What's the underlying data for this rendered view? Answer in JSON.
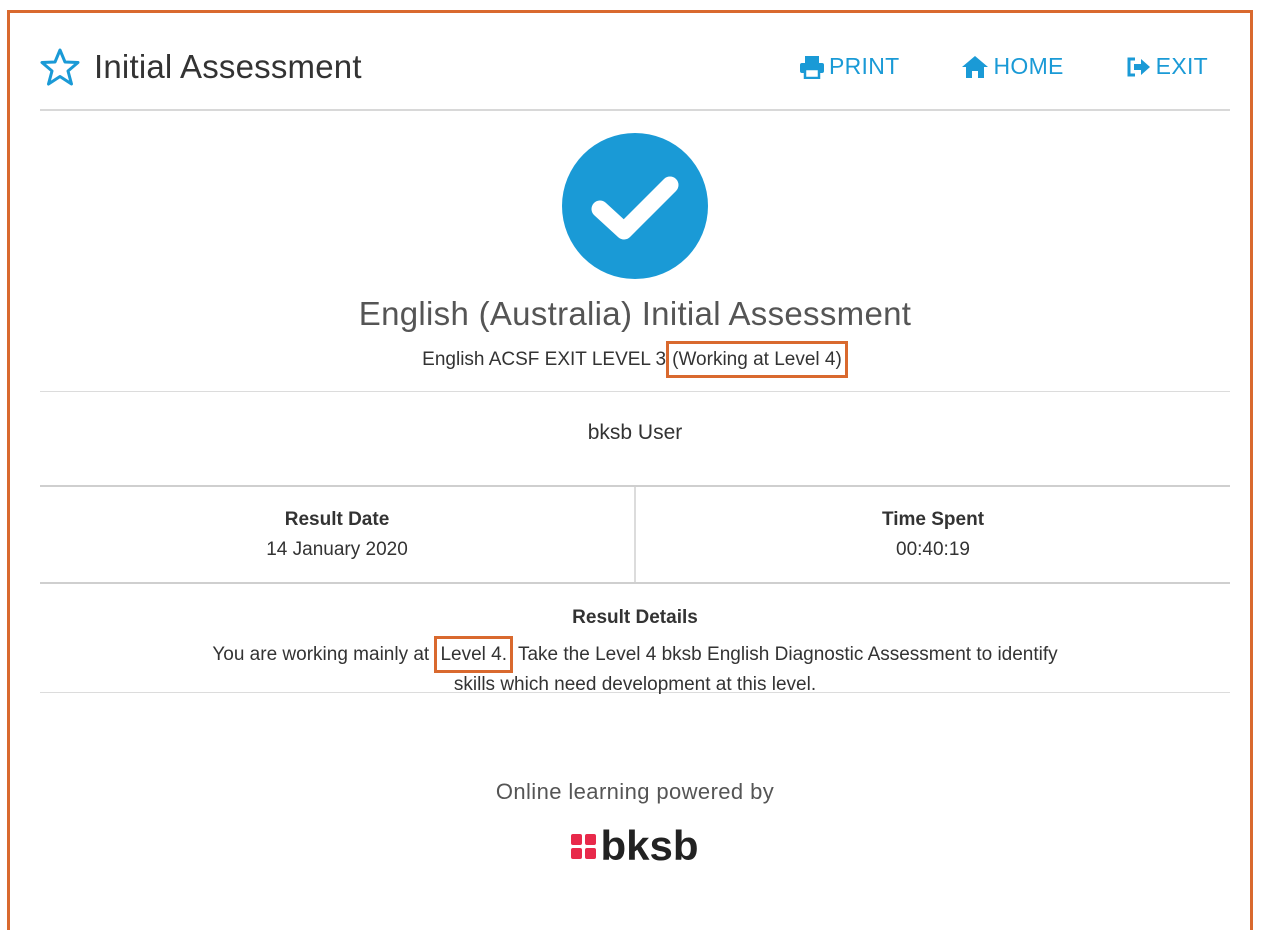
{
  "header": {
    "title": "Initial Assessment",
    "nav": {
      "print": "PRINT",
      "home": "HOME",
      "exit": "EXIT"
    }
  },
  "result": {
    "assessment_title": "English (Australia) Initial Assessment",
    "level_prefix": "English ACSF EXIT LEVEL 3",
    "level_working": "(Working at Level 4)"
  },
  "user": {
    "name": "bksb User"
  },
  "stats": {
    "date_label": "Result Date",
    "date_value": "14 January 2020",
    "time_label": "Time Spent",
    "time_value": "00:40:19"
  },
  "details": {
    "label": "Result Details",
    "text_before": "You are working mainly at",
    "level_highlight": "Level 4.",
    "text_after": " Take the Level 4 bksb English Diagnostic Assessment to identify",
    "text_line2": "skills which need development at this level."
  },
  "footer": {
    "powered_by": "Online learning powered by",
    "logo_text": "bksb"
  },
  "icons": {
    "title_icon": "star-outline-icon",
    "print_icon": "printer-icon",
    "home_icon": "home-icon",
    "exit_icon": "sign-out-icon",
    "result_icon": "check-circle-icon"
  },
  "colors": {
    "accent": "#1a9ad6",
    "highlight_border": "#d9692e",
    "logo_red": "#e8294a"
  }
}
